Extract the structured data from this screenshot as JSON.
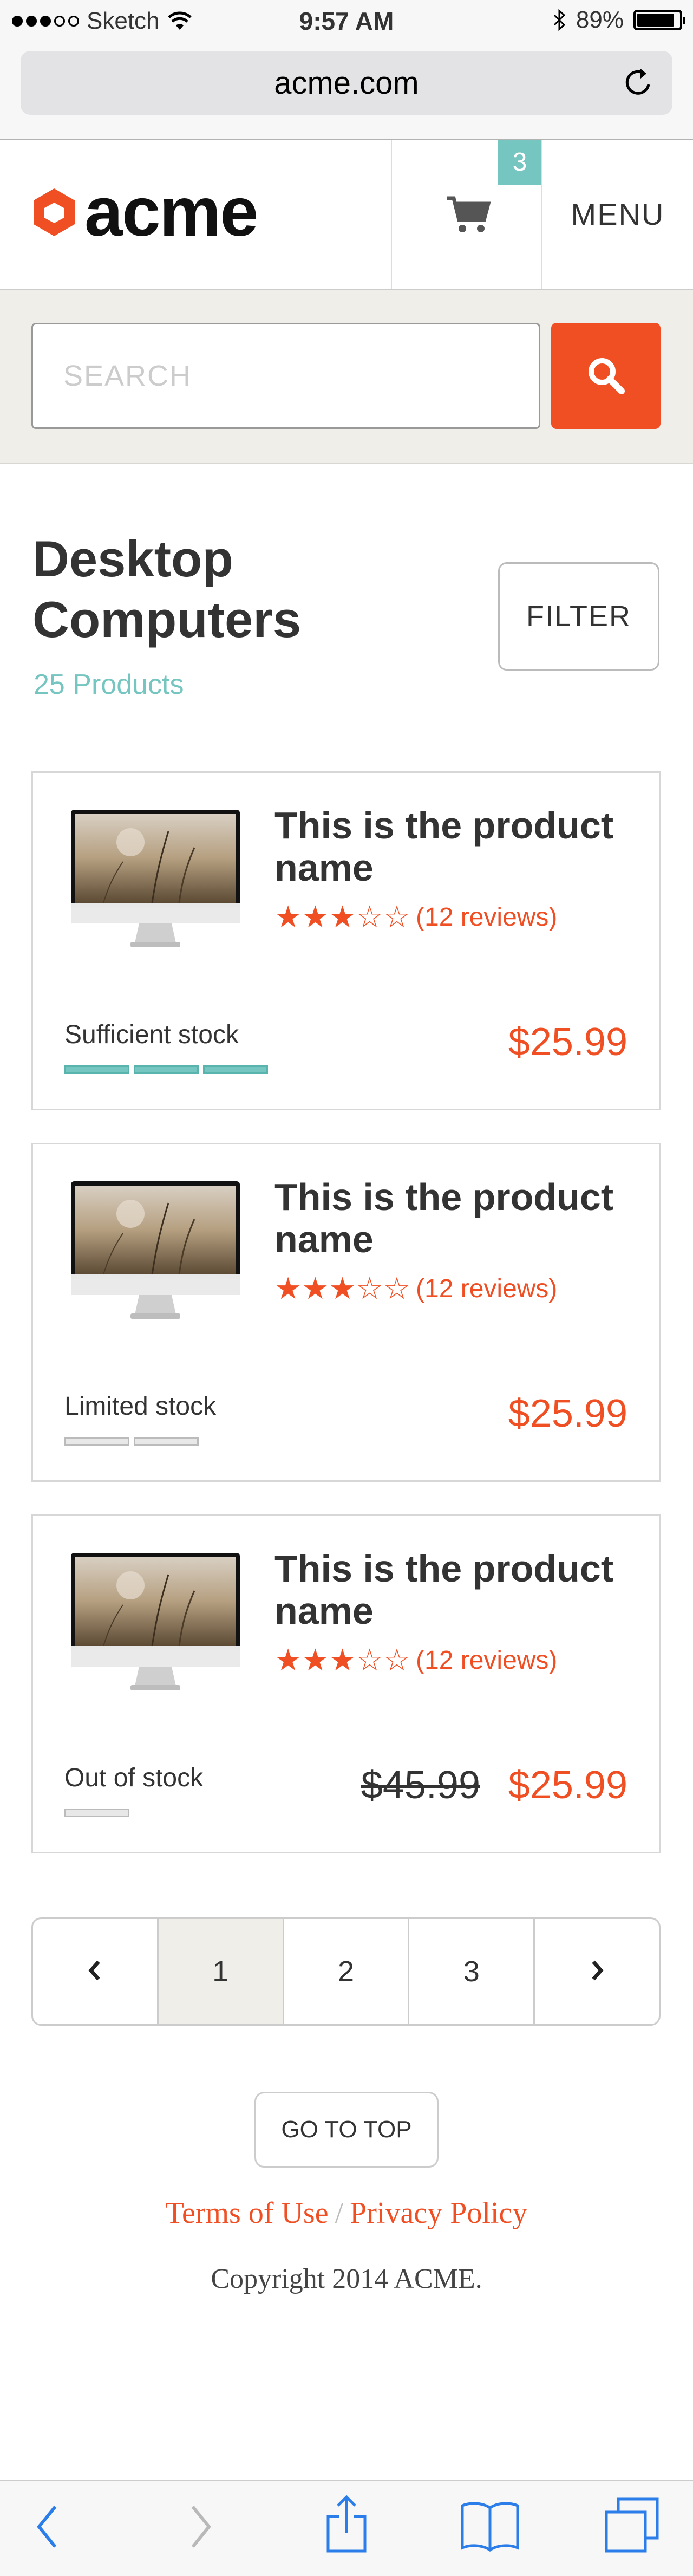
{
  "status": {
    "carrier": "Sketch",
    "time": "9:57 AM",
    "battery": "89%",
    "battery_level": 0.89
  },
  "browser": {
    "url": "acme.com"
  },
  "header": {
    "logo": "acme",
    "cart_count": "3",
    "menu": "MENU"
  },
  "search": {
    "placeholder": "SEARCH"
  },
  "listing": {
    "title_line1": "Desktop",
    "title_line2": "Computers",
    "count": "25 Products",
    "filter": "FILTER"
  },
  "products": [
    {
      "name_line1": "This is the product",
      "name_line2": "name",
      "rating": 3,
      "reviews": "(12 reviews)",
      "stock": "Sufficient stock",
      "stock_level": 3,
      "price": "$25.99"
    },
    {
      "name_line1": "This is the product",
      "name_line2": "name",
      "rating": 3,
      "reviews": "(12 reviews)",
      "stock": "Limited stock",
      "stock_level": 2,
      "price": "$25.99"
    },
    {
      "name_line1": "This is the product",
      "name_line2": "name",
      "rating": 3,
      "reviews": "(12 reviews)",
      "stock": "Out of stock",
      "stock_level": 1,
      "old_price": "$45.99",
      "price": "$25.99"
    }
  ],
  "pagination": {
    "prev": "‹",
    "pages": [
      "1",
      "2",
      "3"
    ],
    "next": "›",
    "current": "1"
  },
  "footer": {
    "top": "GO TO TOP",
    "terms": "Terms of Use",
    "sep": "/",
    "privacy": "Privacy Policy",
    "copyright": "Copyright 2014 ACME."
  },
  "icons": {
    "back": "back-icon",
    "forward": "forward-icon",
    "share": "share-icon",
    "bookmarks": "bookmarks-icon",
    "tabs": "tabs-icon"
  },
  "colors": {
    "accent": "#f04e23",
    "teal": "#75c5c0",
    "panel": "#efeee8"
  }
}
